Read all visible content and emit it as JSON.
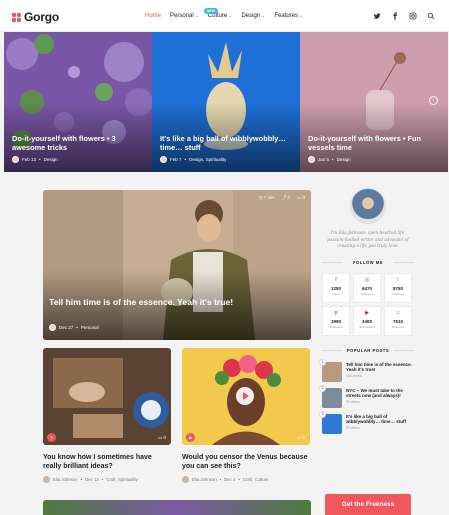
{
  "header": {
    "logo": "Gorgo",
    "nav": [
      {
        "label": "Home",
        "caret": ""
      },
      {
        "label": "Personal",
        "caret": "⌄"
      },
      {
        "label": "Culture",
        "caret": "⌄"
      },
      {
        "label": "Design",
        "caret": "⌄"
      },
      {
        "label": "Features",
        "caret": "⌄"
      }
    ],
    "badge": "NEW",
    "social_icons": [
      "twitter-icon",
      "facebook-icon",
      "instagram-icon",
      "search-icon"
    ],
    "accent": "#f0575e"
  },
  "hero": [
    {
      "title": "Do-it-yourself with flowers • 3 awesome tricks",
      "date": "Feb 13",
      "category": "Design"
    },
    {
      "title": "It's like a big ball of wibblywobbly… time… stuff",
      "date": "Feb 7",
      "category": "Design, Spirituality"
    },
    {
      "title": "Do-it-yourself with flowers • Fun vessels time",
      "date": "Jan 5",
      "category": "Design"
    }
  ],
  "featured": {
    "title": "Tell him time is of the essence. Yeah it's true!",
    "date": "Dec 27",
    "category": "Personal",
    "time": "7 min",
    "shares": "0",
    "comments": "0"
  },
  "cards": [
    {
      "title": "You know how I sometimes have really brilliant ideas?",
      "author": "Elia Johnson",
      "date": "Dec 13",
      "category": "Craft, Spirituality"
    },
    {
      "title": "Would you censor the Venus because you can see this?",
      "author": "Elia Johnson",
      "date": "Dec 4",
      "category": "Craft, Culture"
    }
  ],
  "sidebar": {
    "bio": "I'm Elia Johnson: open-hearted life, passion-fuelled writer and advocate of creating a life you truly love.",
    "follow_heading": "FOLLOW ME",
    "follow": [
      {
        "icon": "f",
        "count": "1250",
        "label": "Likes"
      },
      {
        "icon": "◎",
        "count": "6470",
        "label": "Followers"
      },
      {
        "icon": "t",
        "count": "8780",
        "label": "Followers"
      },
      {
        "icon": "p",
        "count": "1990",
        "label": "Followers"
      },
      {
        "icon": "▶",
        "count": "3400",
        "label": "Subscribers"
      },
      {
        "icon": "♫",
        "count": "7610",
        "label": "Followers"
      }
    ],
    "popular_heading": "POPULAR POSTS",
    "popular": [
      {
        "n": "1",
        "title": "Tell him time is of the essence. Yeah it's true!",
        "views": "106 views"
      },
      {
        "n": "2",
        "title": "NYC – We must take to the streets now (and always)!",
        "views": "96 views"
      },
      {
        "n": "3",
        "title": "It's like a big ball of wibblywobbly… time… stuff",
        "views": "91 views"
      }
    ],
    "cta": "Get the Freeness"
  }
}
